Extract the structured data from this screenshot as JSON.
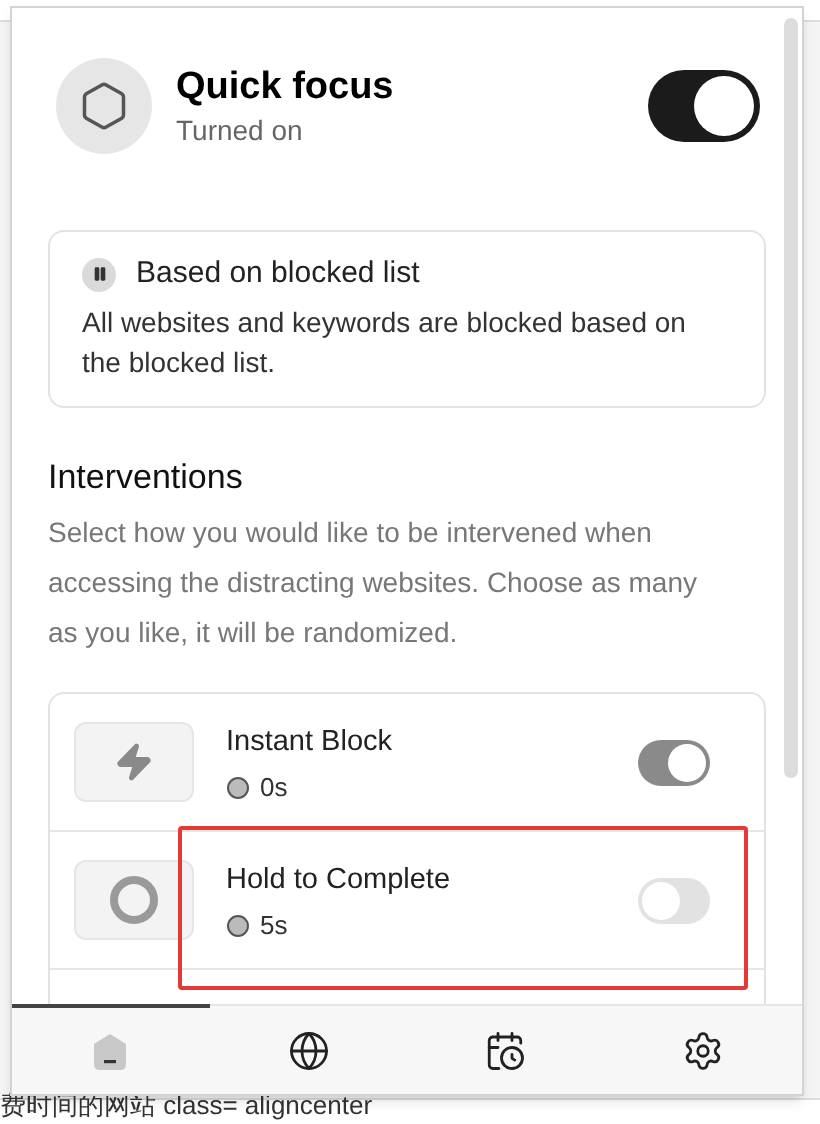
{
  "app": {
    "title": "Quick focus",
    "status": "Turned on",
    "on": true
  },
  "mode_card": {
    "title": "Based on blocked list",
    "description": "All websites and keywords are blocked based on the blocked list."
  },
  "interventions": {
    "heading": "Interventions",
    "description": "Select how you would like to be intervened when accessing the distracting websites. Choose as many as you like, it will be randomized.",
    "items": [
      {
        "kind": "lightning",
        "title": "Instant Block",
        "duration": "0s",
        "on": true,
        "highlighted": false
      },
      {
        "kind": "ring",
        "title": "Hold to Complete",
        "duration": "5s",
        "on": false,
        "highlighted": true
      }
    ]
  },
  "nav": [
    {
      "kind": "home",
      "selected": true
    },
    {
      "kind": "globe",
      "selected": false
    },
    {
      "kind": "calendar",
      "selected": false
    },
    {
      "kind": "settings",
      "selected": false
    }
  ],
  "background_text": "费时间的网站 class= aligncenter"
}
